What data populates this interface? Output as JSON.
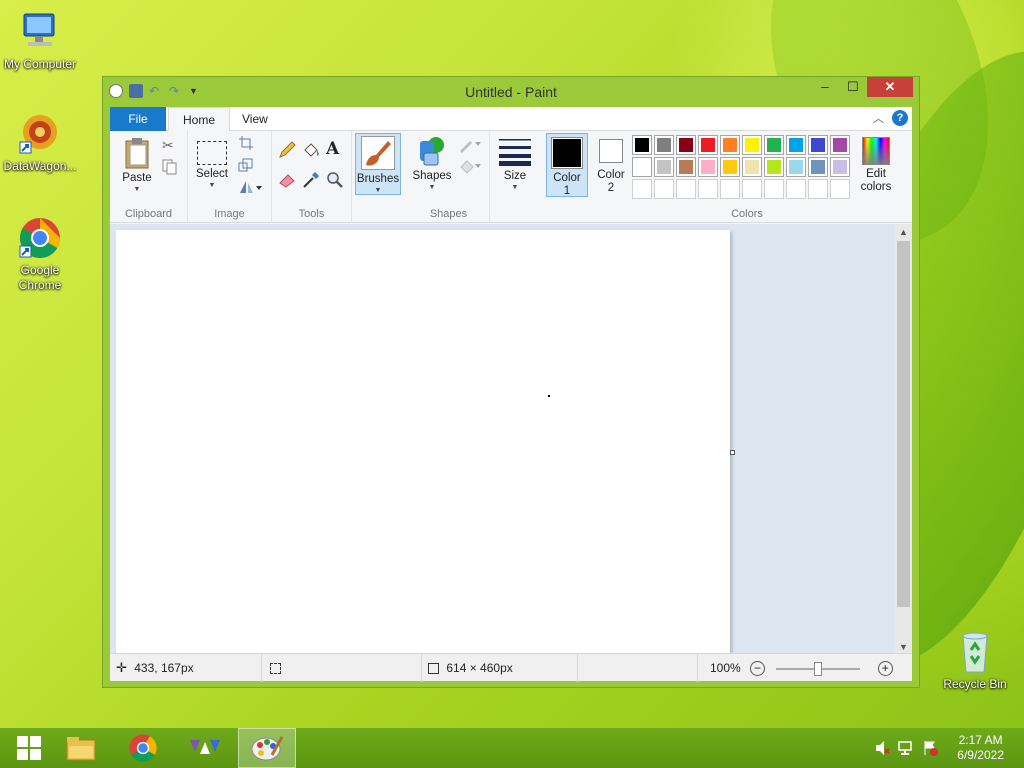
{
  "desktop": {
    "icons": [
      {
        "label": "My Computer"
      },
      {
        "label": "DataWagon..."
      },
      {
        "label": "Google Chrome"
      },
      {
        "label": "Recycle Bin"
      }
    ]
  },
  "window": {
    "title": "Untitled - Paint",
    "controls": {
      "minimize": "–",
      "maximize": "☐",
      "close": "✕"
    }
  },
  "tabs": {
    "file": "File",
    "home": "Home",
    "view": "View",
    "help": "?"
  },
  "ribbon": {
    "clipboard": {
      "paste": "Paste",
      "label": "Clipboard"
    },
    "image": {
      "select": "Select",
      "label": "Image"
    },
    "tools": {
      "label": "Tools",
      "text_tool": "A"
    },
    "brushes": {
      "label": "Brushes"
    },
    "shapes": {
      "shapes": "Shapes",
      "label": "Shapes"
    },
    "size": {
      "label": "Size"
    },
    "colors": {
      "color1": "Color",
      "color1_num": "1",
      "color2": "Color",
      "color2_num": "2",
      "edit_line1": "Edit",
      "edit_line2": "colors",
      "label": "Colors",
      "color1_value": "#000000",
      "color2_value": "#ffffff",
      "row1": [
        "#000000",
        "#7f7f7f",
        "#880015",
        "#ed1c24",
        "#ff7f27",
        "#fff200",
        "#22b14c",
        "#00a2e8",
        "#3f48cc",
        "#a349a4"
      ],
      "row2": [
        "#ffffff",
        "#c3c3c3",
        "#b97a57",
        "#ffaec9",
        "#ffc90e",
        "#efe4b0",
        "#b5e61d",
        "#99d9ea",
        "#7092be",
        "#c8bfe7"
      ],
      "row3": [
        "#ffffff",
        "#ffffff",
        "#ffffff",
        "#ffffff",
        "#ffffff",
        "#ffffff",
        "#ffffff",
        "#ffffff",
        "#ffffff",
        "#ffffff"
      ]
    }
  },
  "status": {
    "cursor_pos": "433, 167px",
    "canvas_size": "614 × 460px",
    "zoom": "100%"
  },
  "taskbar": {
    "time": "2:17 AM",
    "date": "6/9/2022"
  }
}
